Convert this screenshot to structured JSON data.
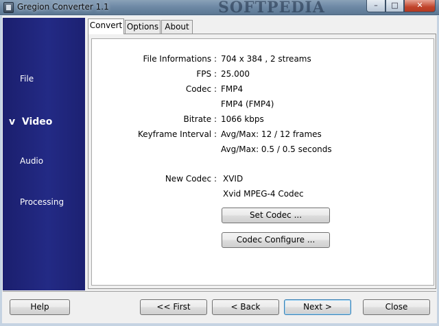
{
  "window": {
    "title": "Gregion Converter 1.1",
    "watermark": "SOFTPEDIA",
    "controls": {
      "minimize": "–",
      "maximize": "□",
      "close": "✕"
    }
  },
  "sidebar": {
    "items": [
      {
        "label": "File"
      },
      {
        "label": "v  Video"
      },
      {
        "label": "Audio"
      },
      {
        "label": "Processing"
      }
    ]
  },
  "tabs": [
    {
      "label": "Convert"
    },
    {
      "label": "Options"
    },
    {
      "label": "About"
    }
  ],
  "info": {
    "file_informations_label": "File Informations :",
    "file_informations_value": "704 x 384 ,  2 streams",
    "fps_label": "FPS :",
    "fps_value": "25.000",
    "codec_label": "Codec :",
    "codec_value": "FMP4",
    "codec_detail": "FMP4 (FMP4)",
    "bitrate_label": "Bitrate :",
    "bitrate_value": "1066 kbps",
    "keyframe_label": "Keyframe Interval :",
    "keyframe_frames": "Avg/Max: 12 / 12 frames",
    "keyframe_seconds": "Avg/Max: 0.5 / 0.5 seconds",
    "new_codec_label": "New Codec :",
    "new_codec_value": "XVID",
    "new_codec_detail": "Xvid MPEG-4 Codec"
  },
  "actions": {
    "set_codec": "Set Codec ...",
    "codec_configure": "Codec Configure ..."
  },
  "footer": {
    "help": "Help",
    "first": "<< First",
    "back": "< Back",
    "next": "Next >",
    "close": "Close"
  },
  "colors": {
    "sidebar": "#232a85",
    "close_button": "#c0442b",
    "focus_border": "#3c7fb1"
  }
}
